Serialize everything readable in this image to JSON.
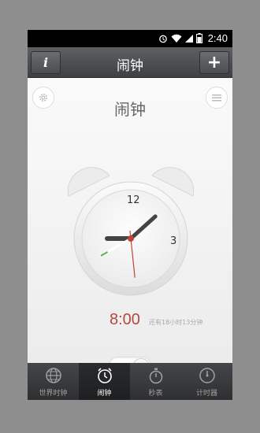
{
  "status_bar": {
    "time": "2:40",
    "icons": [
      "alarm-icon",
      "wifi-icon",
      "signal-icon",
      "battery-icon"
    ]
  },
  "title_bar": {
    "title": "闹钟",
    "info_label": "i",
    "add_label": "+"
  },
  "main": {
    "heading": "闹钟",
    "clock": {
      "numerals": {
        "twelve": "12",
        "three": "3"
      },
      "hand_times": {
        "hour": 9.0,
        "minute": 8.0,
        "second": 29.0
      }
    },
    "alarm_time": "8:00",
    "remaining_text": "还有18小时13分钟",
    "toggle_on": true
  },
  "tabs": [
    {
      "label": "世界时钟",
      "icon": "globe-icon",
      "active": false
    },
    {
      "label": "闹钟",
      "icon": "alarm-clock-icon",
      "active": true
    },
    {
      "label": "秒表",
      "icon": "stopwatch-icon",
      "active": false
    },
    {
      "label": "计时器",
      "icon": "timer-icon",
      "active": false
    }
  ],
  "colors": {
    "accent": "#b4483d",
    "toggle_on": "#5cae52",
    "tab_bar": "#2e2f31"
  }
}
